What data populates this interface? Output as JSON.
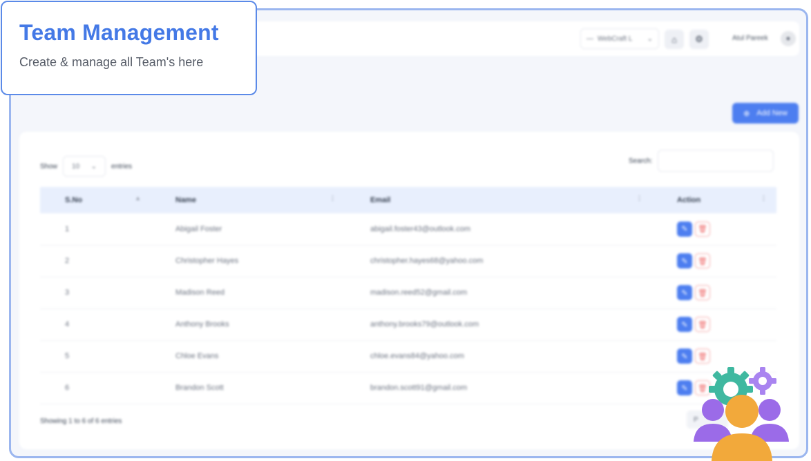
{
  "heading": {
    "title": "Team Management",
    "subtitle": "Create & manage all Team's here"
  },
  "topbar": {
    "company": "WebCraft L",
    "company_prefix": "—",
    "home_icon": "home-icon",
    "settings_icon": "gear-icon",
    "user_name": "Atul Pareek"
  },
  "toolbar": {
    "add_label": "Add New"
  },
  "table_controls": {
    "show_label": "Show",
    "entries_value": "10",
    "entries_label": "entries",
    "search_label": "Search:"
  },
  "table": {
    "columns": [
      "S.No",
      "Name",
      "Email",
      "Action"
    ],
    "rows": [
      {
        "sno": "1",
        "name": "Abigail Foster",
        "email": "abigail.foster43@outlook.com"
      },
      {
        "sno": "2",
        "name": "Christopher Hayes",
        "email": "christopher.hayes68@yahoo.com"
      },
      {
        "sno": "3",
        "name": "Madison Reed",
        "email": "madison.reed52@gmail.com"
      },
      {
        "sno": "4",
        "name": "Anthony Brooks",
        "email": "anthony.brooks79@outlook.com"
      },
      {
        "sno": "5",
        "name": "Chloe Evans",
        "email": "chloe.evans84@yahoo.com"
      },
      {
        "sno": "6",
        "name": "Brandon Scott",
        "email": "brandon.scott91@gmail.com"
      }
    ]
  },
  "footer": {
    "info": "Showing 1 to 6 of 6 entries",
    "pager": "P"
  },
  "colors": {
    "accent": "#4d7ef0",
    "title": "#4479e6",
    "delete": "#ef6b6b"
  }
}
